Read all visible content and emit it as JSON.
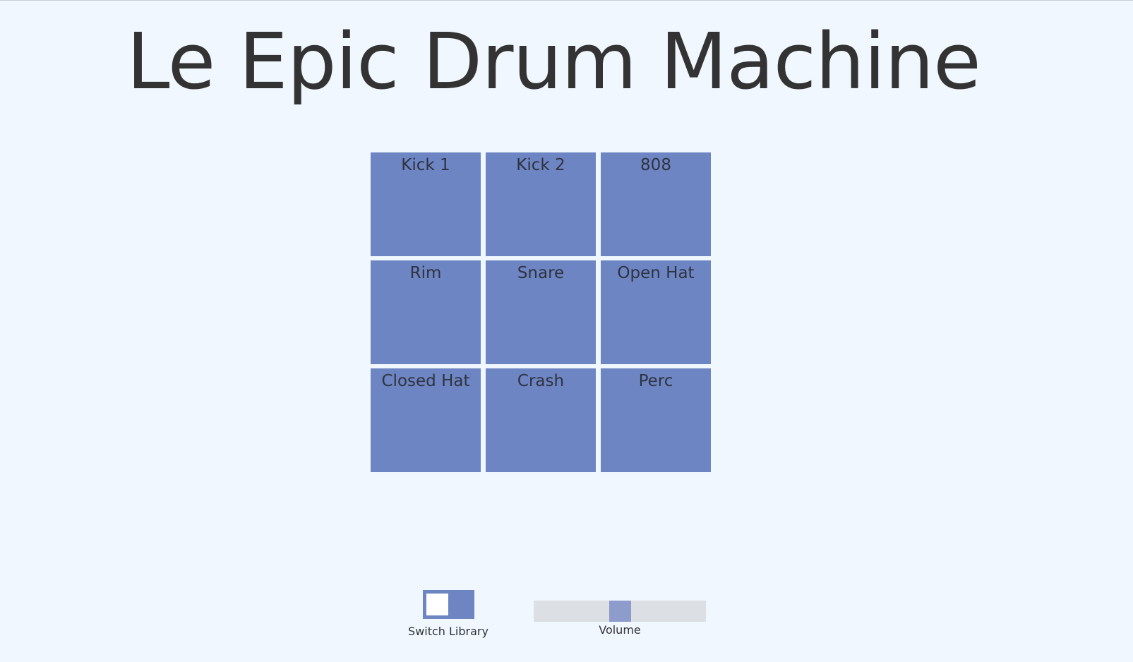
{
  "app": {
    "title": "Le Epic Drum Machine"
  },
  "pads": [
    {
      "label": "Kick 1"
    },
    {
      "label": "Kick 2"
    },
    {
      "label": "808"
    },
    {
      "label": "Rim"
    },
    {
      "label": "Snare"
    },
    {
      "label": "Open Hat"
    },
    {
      "label": "Closed Hat"
    },
    {
      "label": "Crash"
    },
    {
      "label": "Perc"
    }
  ],
  "controls": {
    "library_switch": {
      "label": "Switch Library",
      "on": false
    },
    "volume": {
      "label": "Volume",
      "value": 0.5
    }
  },
  "colors": {
    "background": "#f0f7ff",
    "pad": "#6d85c2",
    "text": "#333333",
    "slider_track": "#dcdfe3",
    "slider_thumb": "#8e9ccc"
  }
}
